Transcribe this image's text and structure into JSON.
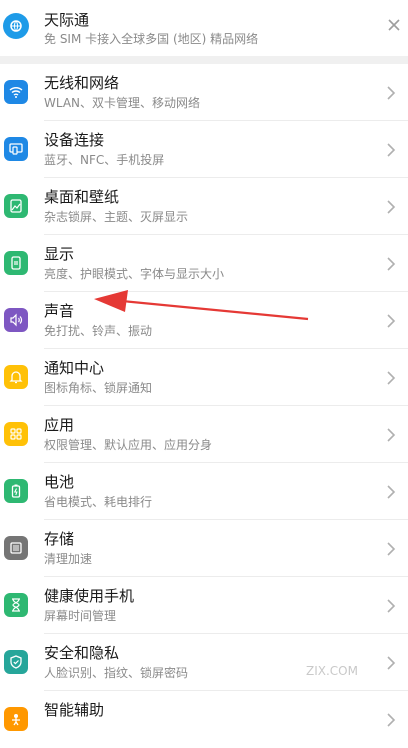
{
  "banner": {
    "title": "天际通",
    "subtitle": "免 SIM 卡接入全球多国 (地区) 精品网络",
    "icon": "globe-icon",
    "close_icon": "close-icon"
  },
  "settings": [
    {
      "title": "无线和网络",
      "subtitle": "WLAN、双卡管理、移动网络",
      "icon": "wifi-icon",
      "color": "#1E88E5"
    },
    {
      "title": "设备连接",
      "subtitle": "蓝牙、NFC、手机投屏",
      "icon": "device-connection-icon",
      "color": "#1E88E5"
    },
    {
      "title": "桌面和壁纸",
      "subtitle": "杂志锁屏、主题、灭屏显示",
      "icon": "wallpaper-icon",
      "color": "#2EB872"
    },
    {
      "title": "显示",
      "subtitle": "亮度、护眼模式、字体与显示大小",
      "icon": "display-icon",
      "color": "#2EB872"
    },
    {
      "title": "声音",
      "subtitle": "免打扰、铃声、振动",
      "icon": "sound-icon",
      "color": "#7E57C2"
    },
    {
      "title": "通知中心",
      "subtitle": "图标角标、锁屏通知",
      "icon": "notification-bell-icon",
      "color": "#FFC107"
    },
    {
      "title": "应用",
      "subtitle": "权限管理、默认应用、应用分身",
      "icon": "apps-grid-icon",
      "color": "#FFC107"
    },
    {
      "title": "电池",
      "subtitle": "省电模式、耗电排行",
      "icon": "battery-icon",
      "color": "#2EB872"
    },
    {
      "title": "存储",
      "subtitle": "清理加速",
      "icon": "storage-icon",
      "color": "#757575"
    },
    {
      "title": "健康使用手机",
      "subtitle": "屏幕时间管理",
      "icon": "hourglass-icon",
      "color": "#2EB872"
    },
    {
      "title": "安全和隐私",
      "subtitle": "人脸识别、指纹、锁屏密码",
      "icon": "shield-icon",
      "color": "#26A69A"
    },
    {
      "title": "智能辅助",
      "subtitle": "",
      "icon": "assist-icon",
      "color": "#FF9800"
    }
  ],
  "annotation": {
    "color": "#E53935"
  },
  "watermark": "ZIX.COM"
}
